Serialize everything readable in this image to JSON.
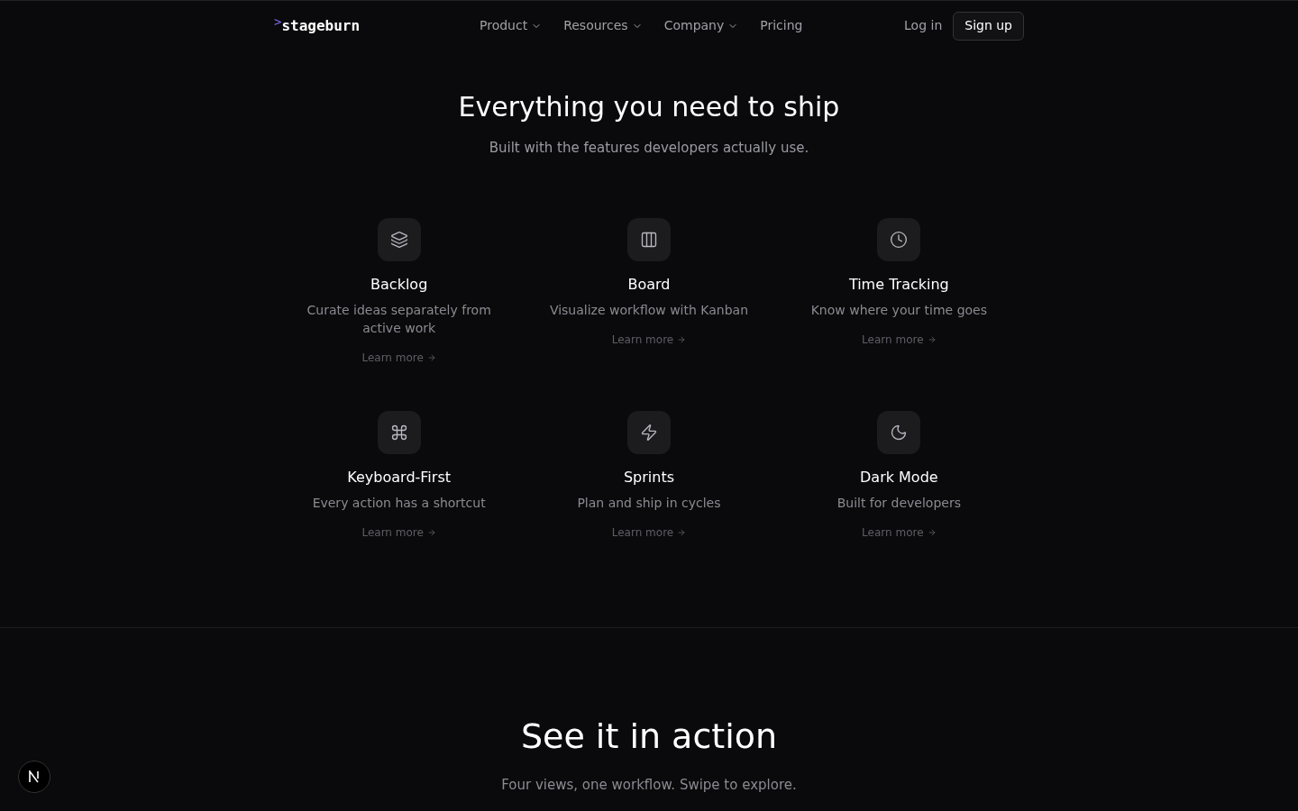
{
  "nav": {
    "logo_mark": ">",
    "logo": "stageburn",
    "links": [
      {
        "label": "Product",
        "dropdown": true
      },
      {
        "label": "Resources",
        "dropdown": true
      },
      {
        "label": "Company",
        "dropdown": true
      },
      {
        "label": "Pricing",
        "dropdown": false
      }
    ],
    "login": "Log in",
    "signup": "Sign up"
  },
  "features_section": {
    "title": "Everything you need to ship",
    "subtitle": "Built with the features developers actually use.",
    "features": [
      {
        "kind": "layers",
        "title": "Backlog",
        "description": "Curate ideas separately from active work",
        "link": "Learn more"
      },
      {
        "kind": "columns",
        "title": "Board",
        "description": "Visualize workflow with Kanban",
        "link": "Learn more"
      },
      {
        "kind": "clock",
        "title": "Time Tracking",
        "description": "Know where your time goes",
        "link": "Learn more"
      },
      {
        "kind": "command",
        "title": "Keyboard-First",
        "description": "Every action has a shortcut",
        "link": "Learn more"
      },
      {
        "kind": "zap",
        "title": "Sprints",
        "description": "Plan and ship in cycles",
        "link": "Learn more"
      },
      {
        "kind": "moon",
        "title": "Dark Mode",
        "description": "Built for developers",
        "link": "Learn more"
      }
    ]
  },
  "action_section": {
    "title": "See it in action",
    "subtitle": "Four views, one workflow. Swipe to explore."
  }
}
